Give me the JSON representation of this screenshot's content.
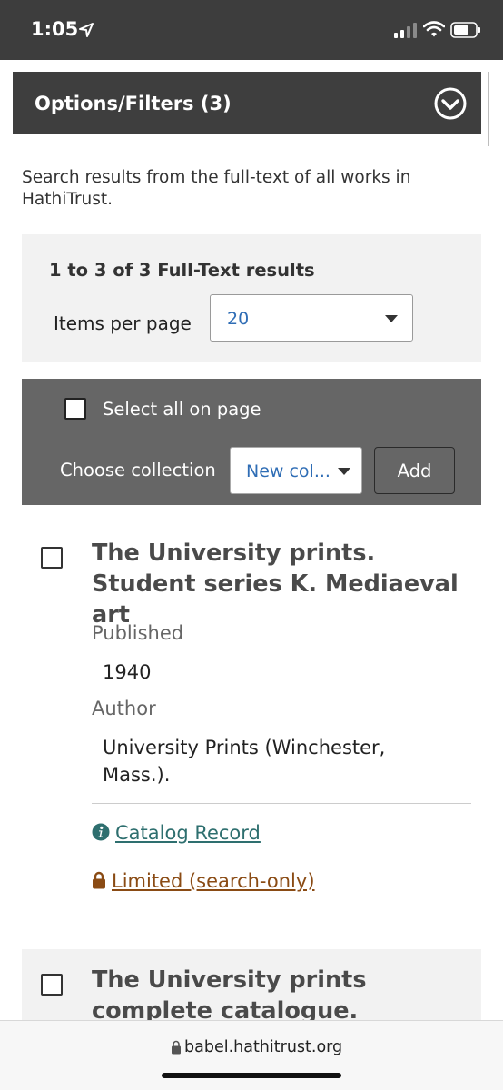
{
  "status_bar": {
    "time": "1:05"
  },
  "options": {
    "title": "Options/Filters (3)"
  },
  "intro_text": "Search results from the full-text of all works in HathiTrust.",
  "summary": {
    "title": "1 to 3 of 3 Full-Text results",
    "per_page_label": "Items per page",
    "per_page_value": "20"
  },
  "toolbar": {
    "select_all_label": "Select all on page",
    "choose_label": "Choose collection",
    "collection_value": "New col...",
    "add_label": "Add"
  },
  "results": [
    {
      "title": "The University prints. Student series K. Mediaeval art",
      "published_label": "Published",
      "published_value": "1940",
      "author_label": "Author",
      "author_value": "University Prints (Winchester, Mass.).",
      "catalog_link": "Catalog Record",
      "access_link": "Limited (search-only)"
    },
    {
      "title": "The University prints complete catalogue."
    }
  ],
  "browser": {
    "url": "babel.hathitrust.org"
  },
  "colors": {
    "link_catalog": "#2e6f6f",
    "link_limited": "#8a4b14",
    "select_value": "#2f6db5",
    "toolbar_bg": "#666666",
    "header_bg": "#3e3e3e"
  }
}
